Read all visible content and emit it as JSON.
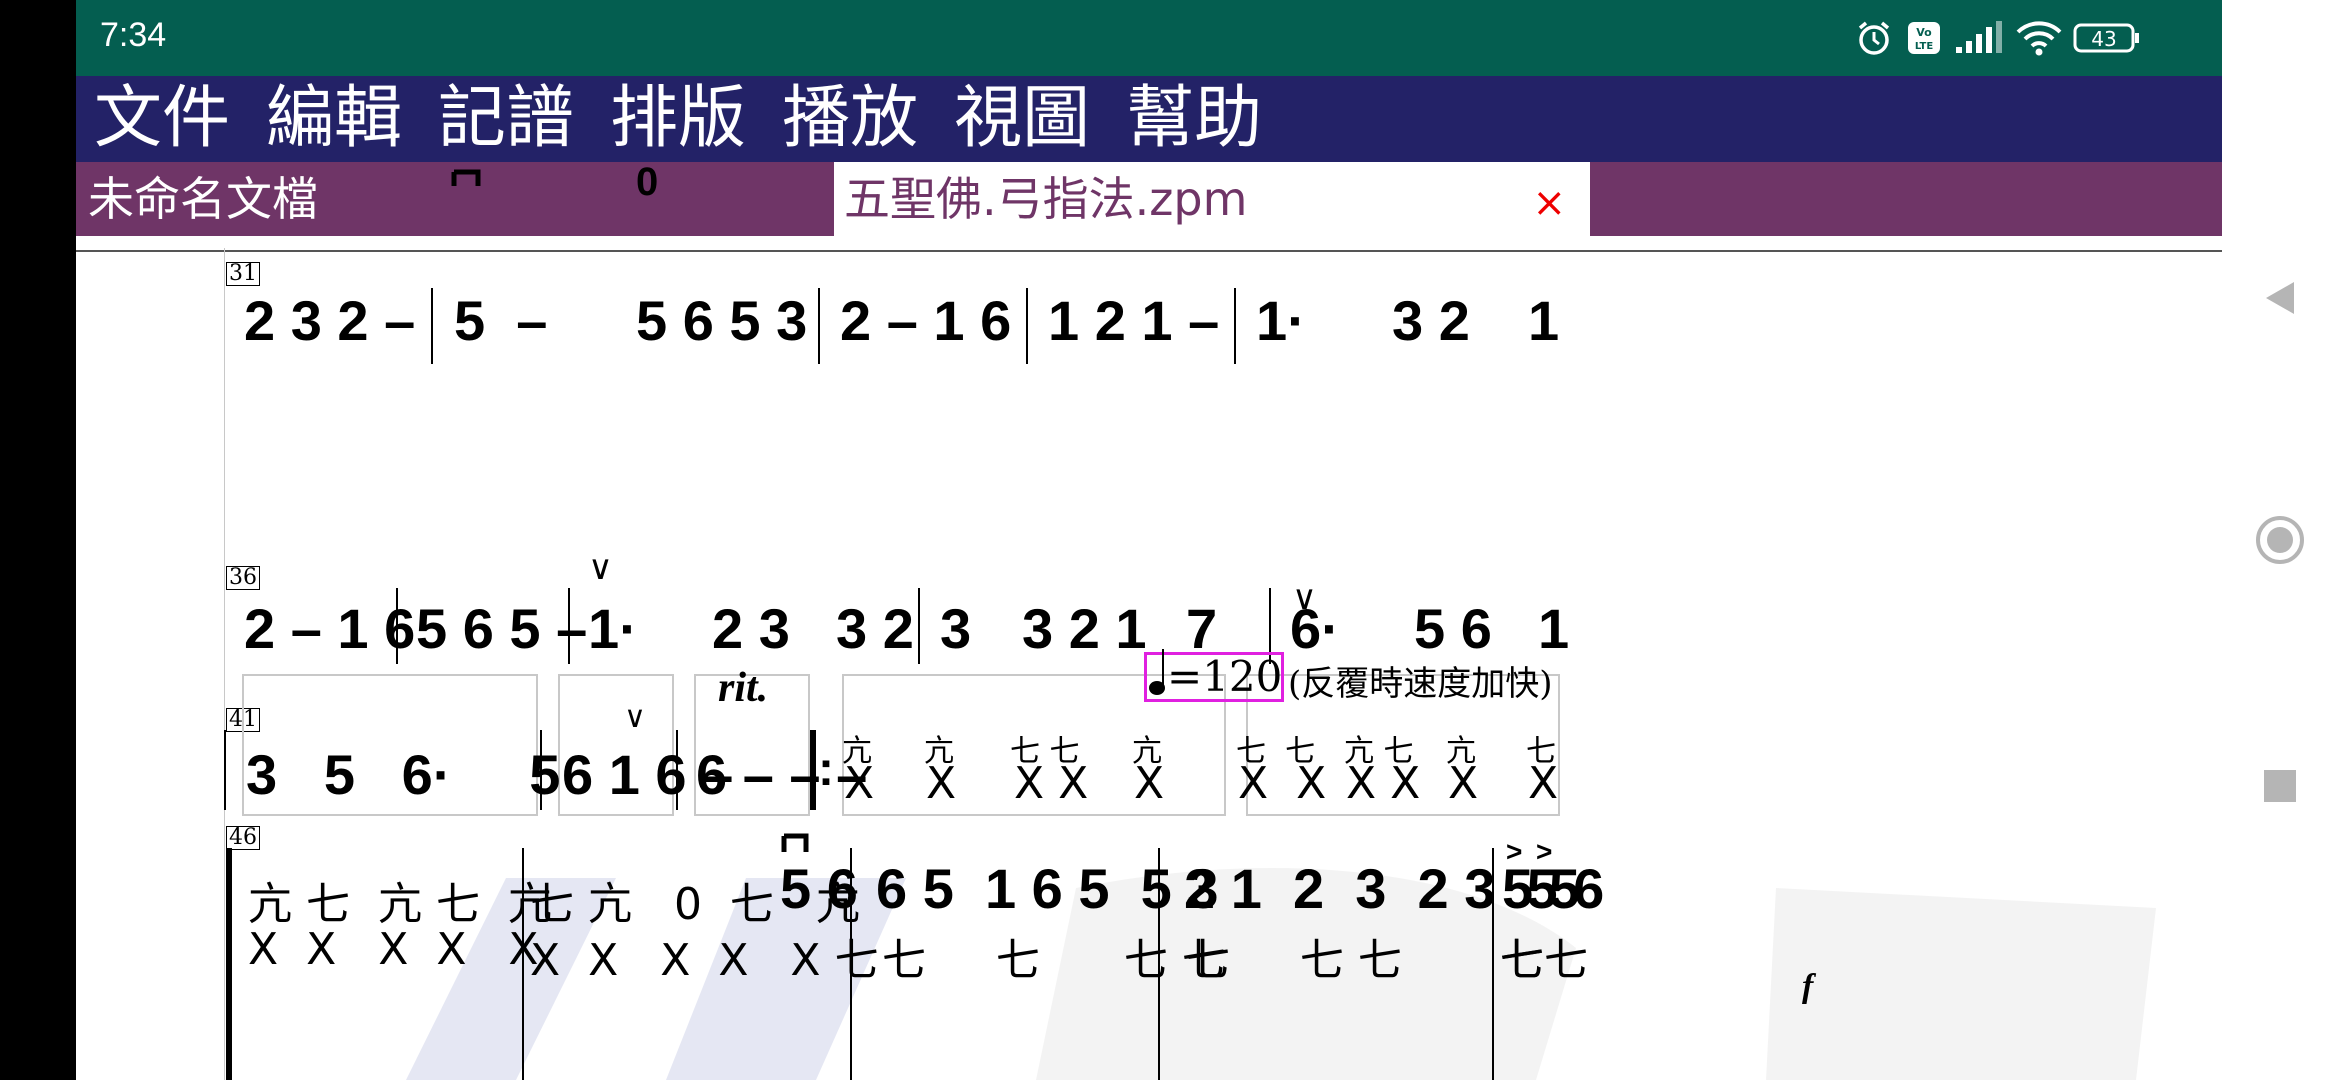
{
  "status_bar": {
    "time": "7:34",
    "icons": [
      "alarm-icon",
      "volte-icon",
      "signal-icon",
      "wifi-icon",
      "battery-icon"
    ],
    "volte_text": "Vo LTE",
    "battery_level": "43"
  },
  "menu": {
    "items": [
      "文件",
      "編輯",
      "記譜",
      "排版",
      "播放",
      "視圖",
      "幫助"
    ]
  },
  "tabs": {
    "untitled": "未命名文檔",
    "active": "五聖佛.弓指法.zpm",
    "close": "×"
  },
  "score": {
    "rows": [
      {
        "measure_number": "31",
        "measures": [
          "2 3 2 –",
          "5  –",
          "5 6 5 3",
          "2 – 1 6",
          "1 2 1 –",
          "1·",
          "3 2",
          "1"
        ],
        "marks": [
          "0",
          "–",
          "∨"
        ]
      },
      {
        "measure_number": "36",
        "measures": [
          "2 – 1 6",
          "5 6 5 –",
          "1·",
          "2 3",
          "3 2",
          "3",
          "3 2 1",
          "7",
          "6·",
          "5 6",
          "1"
        ],
        "marks": [
          "∨",
          "∨"
        ]
      },
      {
        "measure_number": "41",
        "measures": [
          "3   5   6·     5",
          "6 1 6 –",
          "6 – – –",
          ":"
        ],
        "perc_top": [
          "亢",
          "亢",
          "七 七",
          "亢",
          "七  七",
          "亢 七",
          "亢",
          "七"
        ],
        "perc_bottom": [
          "X",
          "X",
          "X X",
          "X",
          "X  X",
          "X X",
          "X",
          "X"
        ],
        "tempo": "=120",
        "tempo_desc": "(反覆時速度加快)",
        "rit": "rit.",
        "marks": [
          "∨"
        ]
      },
      {
        "measure_number": "46",
        "perc_top_1": "亢 七  亢 七  亢",
        "perc_top_2": "七 亢   0  七   亢",
        "perc_bottom_1": "X  X   X  X   X",
        "perc_bottom_2": "X  X   X  X   X 七",
        "notes_1": "5 6",
        "notes_2": "6 5  1 6 5  5 3",
        "notes_3": "2 1  2  3  2 3  5 6",
        "notes_4": "5 5",
        "bottom_perc_3": "七     七      七 七",
        "bottom_perc_4": "七     七 七       七",
        "bottom_perc_5": "七七",
        "forte": "f",
        "marks": [
          ">",
          ">"
        ]
      }
    ]
  },
  "nav": {
    "icons": [
      "back-triangle-icon",
      "home-circle-icon",
      "recents-square-icon"
    ]
  }
}
